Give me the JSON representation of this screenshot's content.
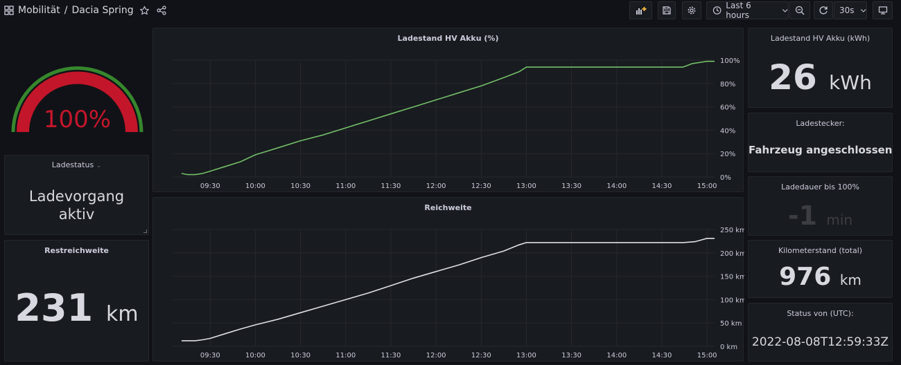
{
  "breadcrumb": {
    "folder": "Mobilität",
    "dashboard": "Dacia Spring"
  },
  "toolbar": {
    "time_range": "Last 6 hours",
    "refresh_interval": "30s"
  },
  "gauge": {
    "value_text": "100%",
    "value": 100,
    "max": 100,
    "color_fill": "#c4162a",
    "color_threshold": "#37872d"
  },
  "panels": {
    "ladestatus": {
      "title": "Ladestatus",
      "value_line1": "Ladevorgang",
      "value_line2": "aktiv"
    },
    "restreichweite": {
      "title": "Restreichweite",
      "value": "231",
      "unit": "km"
    },
    "akku_kwh": {
      "title": "Ladestand HV Akku (kWh)",
      "value": "26",
      "unit": "kWh"
    },
    "ladestecker": {
      "title": "Ladestecker:",
      "value": "Fahrzeug angeschlossen"
    },
    "ladedauer": {
      "title": "Ladedauer bis 100%",
      "value": "-1",
      "unit": "min"
    },
    "kilometerstand": {
      "title": "Kilometerstand (total)",
      "value": "976",
      "unit": "km"
    },
    "status": {
      "title": "Status von (UTC):",
      "value": "2022-08-08T12:59:33Z"
    }
  },
  "chart_data": [
    {
      "type": "line",
      "title": "Ladestand HV Akku (%)",
      "x_ticks": [
        "09:30",
        "10:00",
        "10:30",
        "11:00",
        "11:30",
        "12:00",
        "12:30",
        "13:00",
        "13:30",
        "14:00",
        "14:30",
        "15:00"
      ],
      "y_ticks": [
        "0%",
        "20%",
        "40%",
        "60%",
        "80%",
        "100%"
      ],
      "ylim": [
        0,
        100
      ],
      "xlim": [
        "09:05",
        "15:05"
      ],
      "color": "#73bf69",
      "series": [
        {
          "x": [
            "09:11",
            "09:15",
            "09:20",
            "09:25",
            "09:30",
            "09:40",
            "09:50",
            "10:00",
            "10:15",
            "10:30",
            "10:45",
            "11:00",
            "11:15",
            "11:30",
            "11:45",
            "12:00",
            "12:15",
            "12:30",
            "12:45",
            "12:55",
            "13:00",
            "13:30",
            "14:00",
            "14:30",
            "14:44",
            "14:50",
            "15:00",
            "15:05"
          ],
          "y": [
            3,
            2,
            2,
            3,
            5,
            9,
            13,
            19,
            25,
            31,
            36,
            42,
            48,
            54,
            60,
            66,
            72,
            78,
            85,
            90,
            94,
            94,
            94,
            94,
            94,
            97,
            99,
            99
          ]
        }
      ]
    },
    {
      "type": "line",
      "title": "Reichweite",
      "x_ticks": [
        "09:30",
        "10:00",
        "10:30",
        "11:00",
        "11:30",
        "12:00",
        "12:30",
        "13:00",
        "13:30",
        "14:00",
        "14:30",
        "15:00"
      ],
      "y_ticks": [
        "0 km",
        "50 km",
        "100 km",
        "150 km",
        "200 km",
        "250 km"
      ],
      "ylim": [
        0,
        250
      ],
      "xlim": [
        "09:05",
        "15:05"
      ],
      "color": "#e0e0e6",
      "series": [
        {
          "x": [
            "09:11",
            "09:20",
            "09:25",
            "09:30",
            "09:40",
            "09:50",
            "10:00",
            "10:15",
            "10:30",
            "10:45",
            "11:00",
            "11:15",
            "11:30",
            "11:45",
            "12:00",
            "12:15",
            "12:30",
            "12:45",
            "12:55",
            "13:00",
            "13:30",
            "14:00",
            "14:30",
            "14:44",
            "14:52",
            "15:00",
            "15:05"
          ],
          "y": [
            12,
            12,
            14,
            17,
            27,
            37,
            46,
            58,
            72,
            86,
            100,
            114,
            130,
            146,
            160,
            174,
            190,
            204,
            217,
            222,
            222,
            222,
            222,
            222,
            224,
            231,
            231
          ]
        }
      ]
    }
  ]
}
